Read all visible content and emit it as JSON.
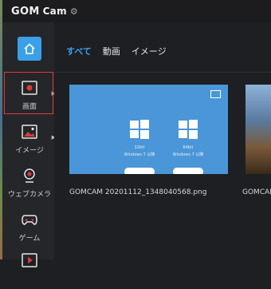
{
  "app": {
    "logo_main": "GOM",
    "logo_sub": "Cam"
  },
  "sidebar": {
    "items": [
      {
        "label": "画面",
        "icon": "screen-record-icon"
      },
      {
        "label": "イメージ",
        "icon": "image-icon"
      },
      {
        "label": "ウェブカメラ",
        "icon": "webcam-icon"
      },
      {
        "label": "ゲーム",
        "icon": "gamepad-icon"
      },
      {
        "label": "",
        "icon": "play-icon"
      }
    ]
  },
  "tabs": [
    {
      "label": "すべて",
      "active": true
    },
    {
      "label": "動画",
      "active": false
    },
    {
      "label": "イメージ",
      "active": false
    }
  ],
  "thumb": {
    "left_caption": "32bit",
    "left_sub": "Windows 7 以降",
    "right_caption": "64bit",
    "right_sub": "Windows 7 以降"
  },
  "files": [
    {
      "name": "GOMCAM 20201112_1348040568.png"
    },
    {
      "name": "GOMCAM"
    }
  ],
  "colors": {
    "accent": "#3aa0e8",
    "highlight": "#e03a3a"
  }
}
